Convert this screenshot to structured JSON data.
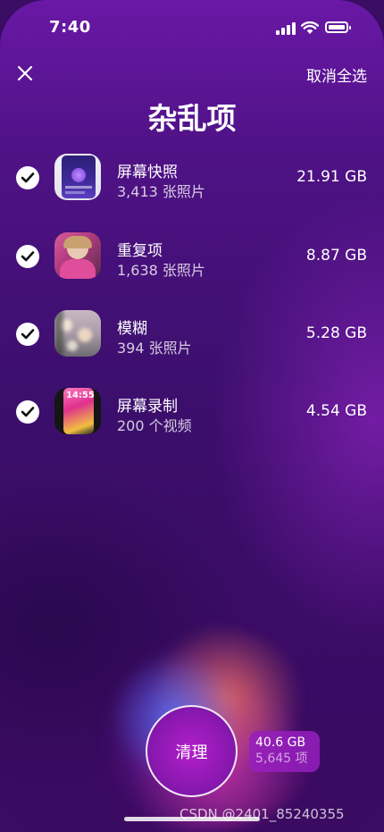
{
  "status_bar": {
    "time": "7:40"
  },
  "header": {
    "deselect_all_label": "取消全选",
    "title": "杂乱项"
  },
  "items": [
    {
      "name": "屏幕快照",
      "count": "3,413 张照片",
      "size": "21.91 GB",
      "icon": "screenshot-thumbnail"
    },
    {
      "name": "重复项",
      "count": "1,638 张照片",
      "size": "8.87 GB",
      "icon": "duplicate-photo-thumbnail"
    },
    {
      "name": "模糊",
      "count": "394 张照片",
      "size": "5.28 GB",
      "icon": "blurry-photo-thumbnail"
    },
    {
      "name": "屏幕录制",
      "count": "200 个视频",
      "size": "4.54 GB",
      "icon": "screen-recording-thumbnail",
      "thumb_text": "14:55"
    }
  ],
  "clean_button": {
    "label": "清理"
  },
  "summary": {
    "total_size": "40.6 GB",
    "total_items": "5,645 项"
  },
  "watermark": "CSDN @2401_85240355",
  "colors": {
    "background": "#3d0f6e",
    "accent": "#9a1cc0"
  }
}
